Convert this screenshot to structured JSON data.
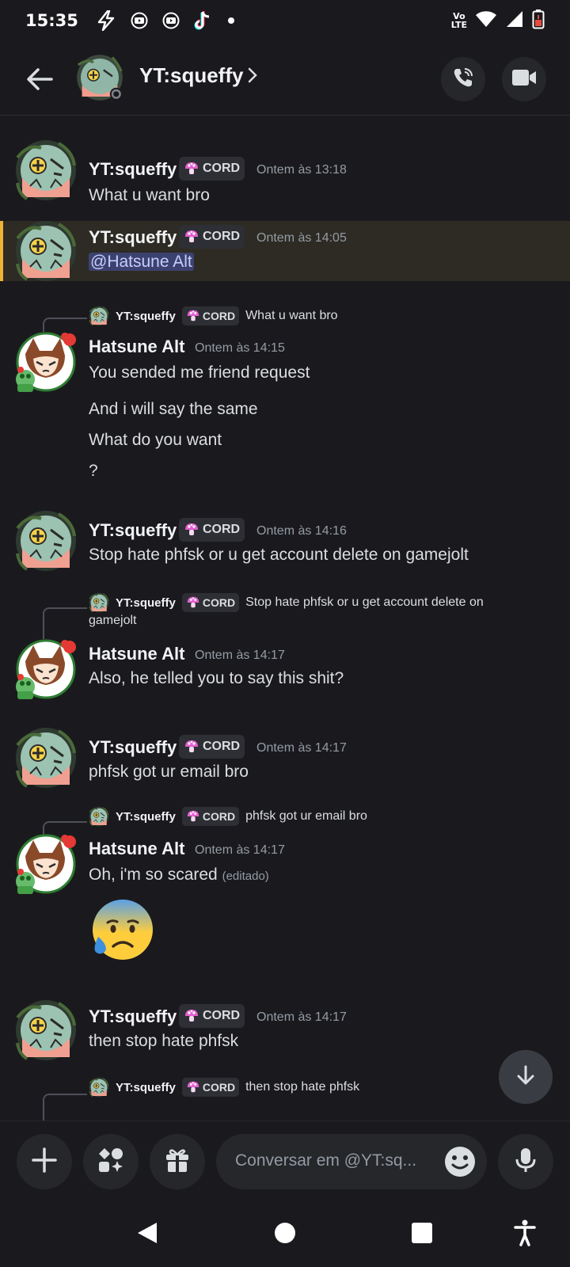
{
  "status_bar": {
    "time": "15:35",
    "volte": "Vo",
    "lte": "LTE"
  },
  "header": {
    "title": "YT:squeffy"
  },
  "tag_label": "CORD",
  "messages": [
    {
      "author": "YT:squeffy",
      "tag": "CORD",
      "timestamp": "Ontem às 13:18",
      "text": "What u want bro"
    },
    {
      "author": "YT:squeffy",
      "tag": "CORD",
      "timestamp": "Ontem às 14:05",
      "text": "@Hatsune Alt"
    },
    {
      "reply_author": "YT:squeffy",
      "reply_tag": "CORD",
      "reply_text": "What u want bro",
      "author": "Hatsune Alt",
      "timestamp": "Ontem às 14:15",
      "lines": [
        "You sended me friend request",
        "And i will say the same",
        "What do you want",
        "?"
      ]
    },
    {
      "author": "YT:squeffy",
      "tag": "CORD",
      "timestamp": "Ontem às 14:16",
      "text": "Stop hate phfsk or u get account delete on gamejolt"
    },
    {
      "reply_author": "YT:squeffy",
      "reply_tag": "CORD",
      "reply_text": "Stop hate phfsk or u get account delete on",
      "reply_text2": "gamejolt",
      "author": "Hatsune Alt",
      "timestamp": "Ontem às 14:17",
      "text": "Also, he telled you to say this shit?"
    },
    {
      "author": "YT:squeffy",
      "tag": "CORD",
      "timestamp": "Ontem às 14:17",
      "text": "phfsk got ur email bro"
    },
    {
      "reply_author": "YT:squeffy",
      "reply_tag": "CORD",
      "reply_text": "phfsk got ur email bro",
      "author": "Hatsune Alt",
      "timestamp": "Ontem às 14:17",
      "text": "Oh, i'm so scared",
      "edited": "(editado)",
      "emoji": "anxious-face-with-sweat"
    },
    {
      "author": "YT:squeffy",
      "tag": "CORD",
      "timestamp": "Ontem às 14:17",
      "text": "then stop hate phfsk"
    },
    {
      "reply_author": "YT:squeffy",
      "reply_tag": "CORD",
      "reply_text": "then stop hate phfsk"
    }
  ],
  "composer": {
    "placeholder": "Conversar em @YT:sq..."
  },
  "colors": {
    "background": "#1a1a1e",
    "mention_highlight": "#2d2b24",
    "mention_bar": "#f0b232",
    "tag_pink": "#e35fd0"
  }
}
